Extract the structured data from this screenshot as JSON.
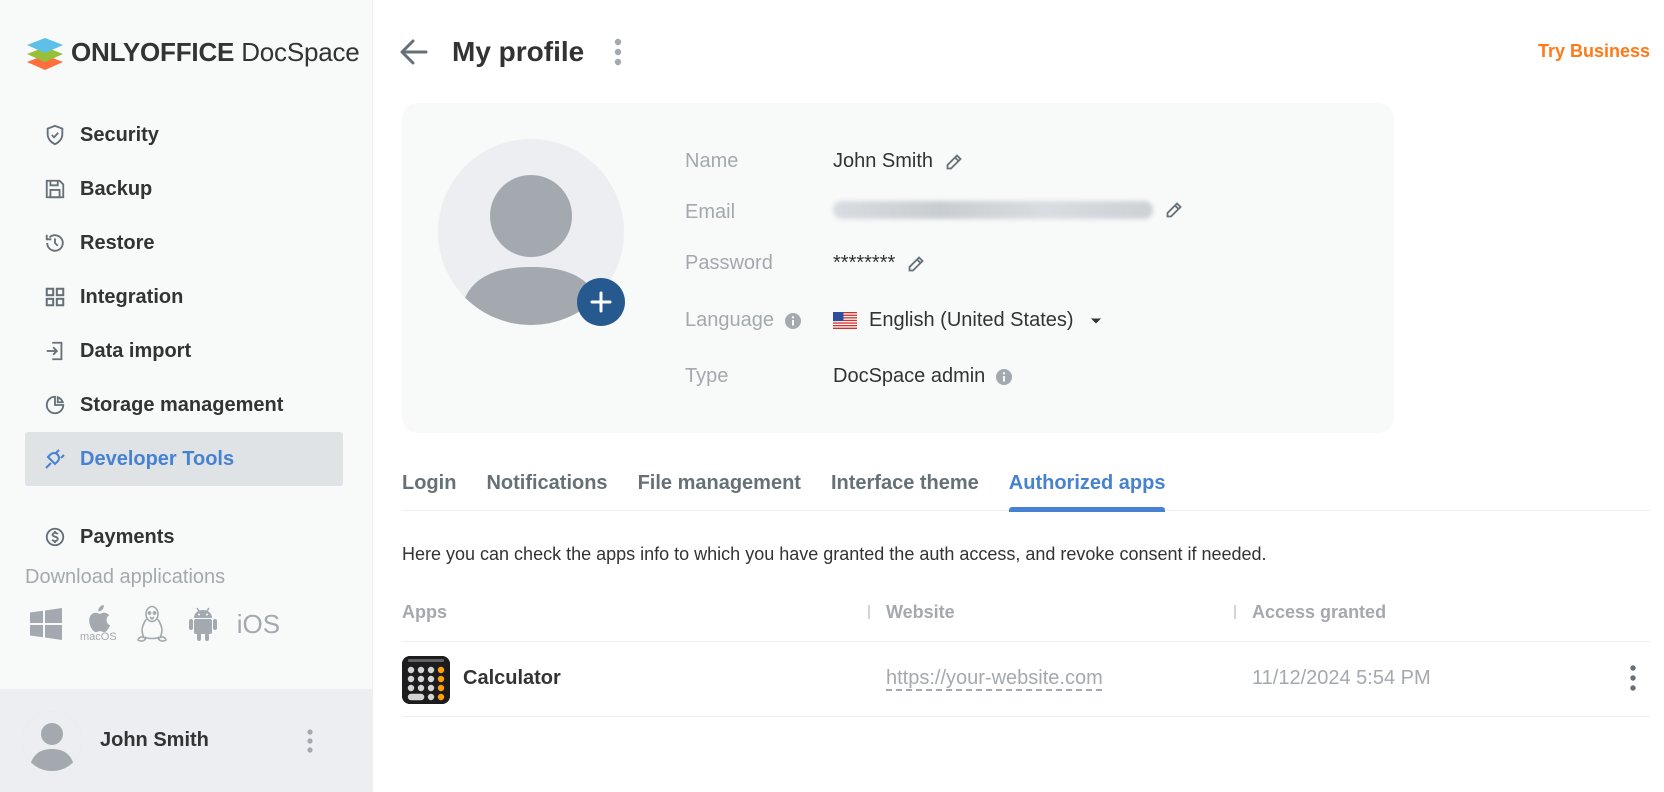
{
  "brand": {
    "logo_bold": "ONLYOFFICE",
    "logo_light": "DocSpace"
  },
  "sidebar": {
    "items": [
      {
        "label": "Security",
        "icon": "shield-icon"
      },
      {
        "label": "Backup",
        "icon": "floppy-icon"
      },
      {
        "label": "Restore",
        "icon": "history-icon"
      },
      {
        "label": "Integration",
        "icon": "grid-icon"
      },
      {
        "label": "Data import",
        "icon": "import-icon"
      },
      {
        "label": "Storage management",
        "icon": "pie-chart-icon"
      },
      {
        "label": "Developer Tools",
        "icon": "plug-icon",
        "active": true
      },
      {
        "label": "Payments",
        "icon": "dollar-circle-icon"
      }
    ],
    "download_title": "Download applications",
    "download_apps": {
      "macos_label": "macOS",
      "ios_label": "iOS"
    },
    "user_name": "John Smith"
  },
  "header": {
    "title": "My profile",
    "try_business": "Try Business"
  },
  "profile": {
    "name_label": "Name",
    "name_value": "John Smith",
    "email_label": "Email",
    "password_label": "Password",
    "password_value": "********",
    "language_label": "Language",
    "language_value": "English (United States)",
    "type_label": "Type",
    "type_value": "DocSpace admin"
  },
  "tabs": [
    {
      "label": "Login"
    },
    {
      "label": "Notifications"
    },
    {
      "label": "File management"
    },
    {
      "label": "Interface theme"
    },
    {
      "label": "Authorized apps",
      "active": true
    }
  ],
  "authorized_apps": {
    "description": "Here you can check the apps info to which you have granted the auth access, and revoke consent if needed.",
    "columns": {
      "apps": "Apps",
      "website": "Website",
      "access": "Access granted"
    },
    "rows": [
      {
        "name": "Calculator",
        "website": "https://your-website.com",
        "granted": "11/12/2024 5:54 PM"
      }
    ]
  },
  "colors": {
    "accent": "#4781d1",
    "try_business": "#ff7916",
    "avatar_button": "#265a8f"
  }
}
